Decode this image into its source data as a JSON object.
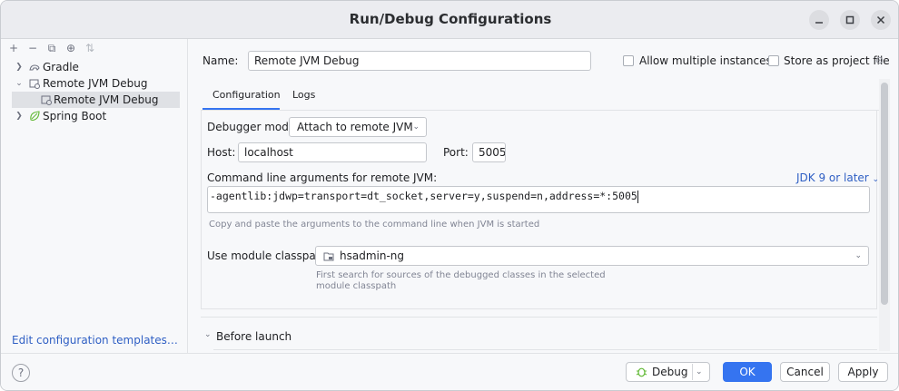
{
  "window": {
    "title": "Run/Debug Configurations"
  },
  "titlebar_buttons": {
    "minimize": "–",
    "maximize": "□",
    "close": "✕"
  },
  "toolbar": {
    "add": "+",
    "remove": "−",
    "copy": "⧉",
    "new_folder": "⊕",
    "sort": "⇅"
  },
  "tree": {
    "items": [
      {
        "label": "Gradle",
        "icon": "gradle-icon",
        "expanded": false
      },
      {
        "label": "Remote JVM Debug",
        "icon": "remote-jvm-debug-icon",
        "expanded": true
      },
      {
        "label": "Remote JVM Debug",
        "icon": "remote-jvm-debug-icon",
        "selected": true
      },
      {
        "label": "Spring Boot",
        "icon": "spring-boot-icon",
        "expanded": false
      }
    ]
  },
  "edit_templates_link": "Edit configuration templates…",
  "form": {
    "name_label": "Name:",
    "name_value": "Remote JVM Debug",
    "allow_multiple_label": "Allow multiple instances",
    "store_project_label": "Store as project file",
    "tabs": [
      "Configuration",
      "Logs"
    ],
    "debugger_mode_label": "Debugger mode:",
    "debugger_mode_value": "Attach to remote JVM",
    "host_label": "Host:",
    "host_value": "localhost",
    "port_label": "Port:",
    "port_value": "5005",
    "cmdline_label": "Command line arguments for remote JVM:",
    "jdk_link": "JDK 9 or later",
    "cmdline_value": "-agentlib:jdwp=transport=dt_socket,server=y,suspend=n,address=*:5005",
    "cmdline_hint": "Copy and paste the arguments to the command line when JVM is started",
    "module_label": "Use module classpath:",
    "module_value": "hsadmin-ng",
    "module_hint_1": "First search for sources of the debugged classes in the selected",
    "module_hint_2": "module classpath",
    "before_launch_label": "Before launch"
  },
  "buttons": {
    "help": "?",
    "debug": "Debug",
    "ok": "OK",
    "cancel": "Cancel",
    "apply": "Apply"
  },
  "colors": {
    "accent": "#3574f0",
    "link": "#2f5fc4"
  }
}
